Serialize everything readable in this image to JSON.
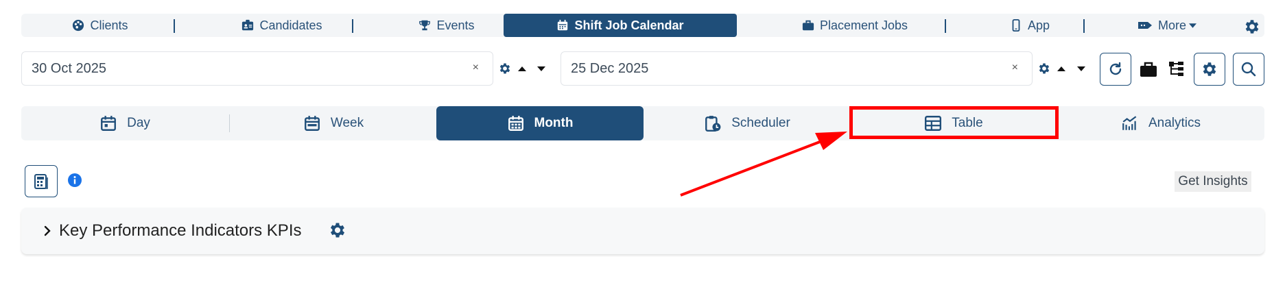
{
  "nav": {
    "items": [
      {
        "label": "Clients",
        "icon": "palette-icon"
      },
      {
        "label": "Candidates",
        "icon": "id-badge-icon"
      },
      {
        "label": "Events",
        "icon": "trophy-icon"
      },
      {
        "label": "Shift Job Calendar",
        "icon": "calendar-icon",
        "active": true
      },
      {
        "label": "Placement Jobs",
        "icon": "briefcase-icon"
      },
      {
        "label": "App",
        "icon": "mobile-icon"
      },
      {
        "label": "More",
        "icon": "tag-icon"
      }
    ]
  },
  "dates": {
    "start": "30 Oct 2025",
    "end": "25 Dec 2025",
    "clear_symbol": "×"
  },
  "views": {
    "tabs": [
      {
        "label": "Day",
        "icon": "calendar-day-icon"
      },
      {
        "label": "Week",
        "icon": "calendar-week-icon"
      },
      {
        "label": "Month",
        "icon": "calendar-month-icon",
        "active": true
      },
      {
        "label": "Scheduler",
        "icon": "clipboard-clock-icon"
      },
      {
        "label": "Table",
        "icon": "table-icon",
        "highlighted": true
      },
      {
        "label": "Analytics",
        "icon": "chart-line-icon"
      }
    ]
  },
  "toolbar": {
    "insights_label": "Get Insights"
  },
  "kpi": {
    "title": "Key Performance Indicators KPIs"
  },
  "colors": {
    "primary": "#1f4e79",
    "highlight": "#ff0000",
    "info": "#1a73e8"
  }
}
